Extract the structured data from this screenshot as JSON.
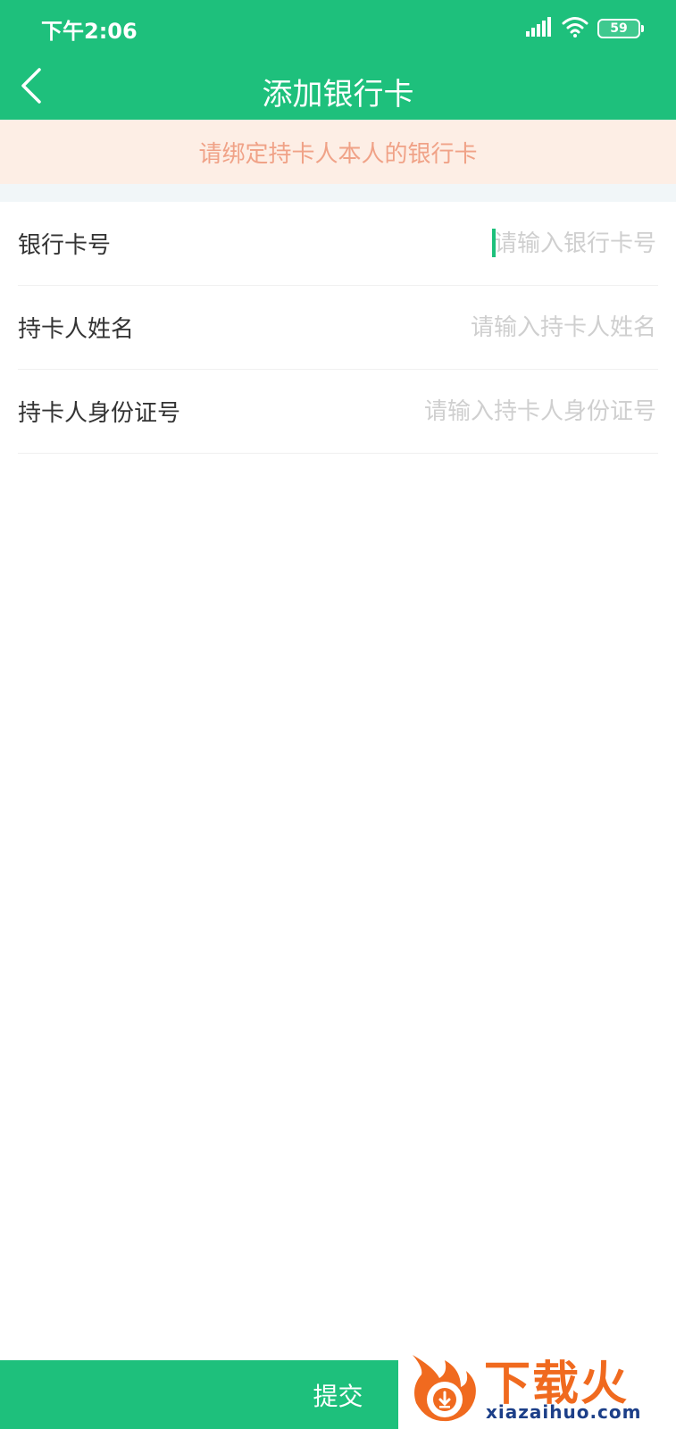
{
  "status_bar": {
    "time": "下午2:06",
    "battery": "59",
    "icons": [
      "signal-icon",
      "wifi-icon",
      "battery-icon"
    ]
  },
  "nav": {
    "title": "添加银行卡",
    "back_icon": "chevron-left-icon"
  },
  "notice": {
    "text": "请绑定持卡人本人的银行卡"
  },
  "form": {
    "fields": [
      {
        "label": "银行卡号",
        "placeholder": "请输入银行卡号",
        "value": ""
      },
      {
        "label": "持卡人姓名",
        "placeholder": "请输入持卡人姓名",
        "value": ""
      },
      {
        "label": "持卡人身份证号",
        "placeholder": "请输入持卡人身份证号",
        "value": ""
      }
    ]
  },
  "submit": {
    "label": "提交"
  },
  "watermark": {
    "name": "下载火",
    "url": "xiazaihuo.com"
  },
  "colors": {
    "primary": "#1ec07c",
    "notice_bg": "#fdeee5",
    "notice_text": "#f0a287"
  }
}
